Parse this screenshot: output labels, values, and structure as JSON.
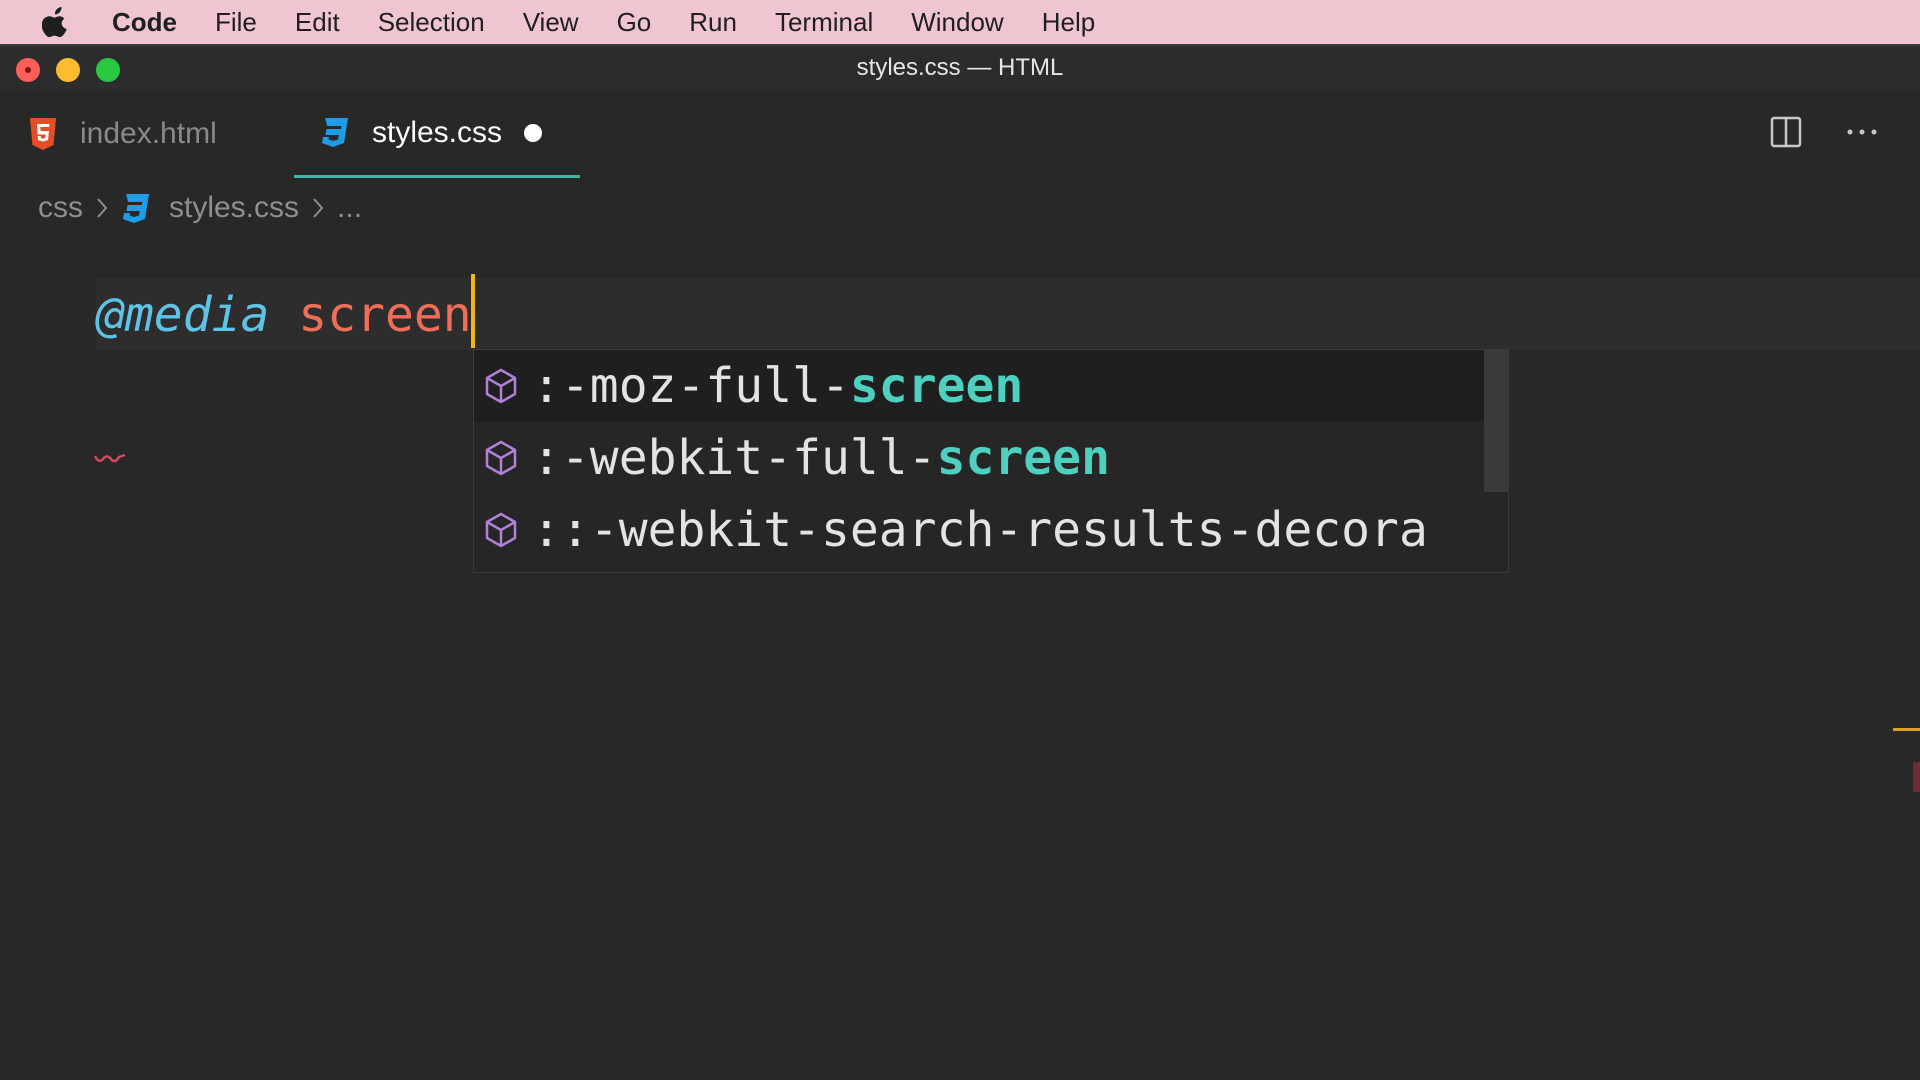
{
  "menubar": {
    "apple": "apple-icon",
    "items": [
      {
        "label": "Code",
        "bold": true
      },
      {
        "label": "File"
      },
      {
        "label": "Edit"
      },
      {
        "label": "Selection"
      },
      {
        "label": "View"
      },
      {
        "label": "Go"
      },
      {
        "label": "Run"
      },
      {
        "label": "Terminal"
      },
      {
        "label": "Window"
      },
      {
        "label": "Help"
      }
    ]
  },
  "window": {
    "title": "styles.css — HTML"
  },
  "tabs": [
    {
      "label": "index.html",
      "icon": "html5-icon",
      "active": false
    },
    {
      "label": "styles.css",
      "icon": "css3-icon",
      "active": true,
      "modified": true
    }
  ],
  "breadcrumb": {
    "folder": "css",
    "file": "styles.css",
    "more": "..."
  },
  "editor": {
    "at_rule": "@media",
    "keyword": "screen"
  },
  "suggestions": [
    {
      "prefix": ":-moz-full-",
      "match": "screen",
      "selected": true
    },
    {
      "prefix": ":-webkit-full-",
      "match": "screen",
      "selected": false
    },
    {
      "prefix": "::-webkit-search-results-decora",
      "match": "",
      "selected": false
    }
  ],
  "colors": {
    "menubar_bg": "#efc5cf",
    "editor_bg": "#282828",
    "accent_tab": "#3fb5a8",
    "at_rule": "#5fc3e6",
    "keyword": "#ee6e59",
    "match": "#4dd0c0",
    "cursor": "#f2b41c"
  }
}
